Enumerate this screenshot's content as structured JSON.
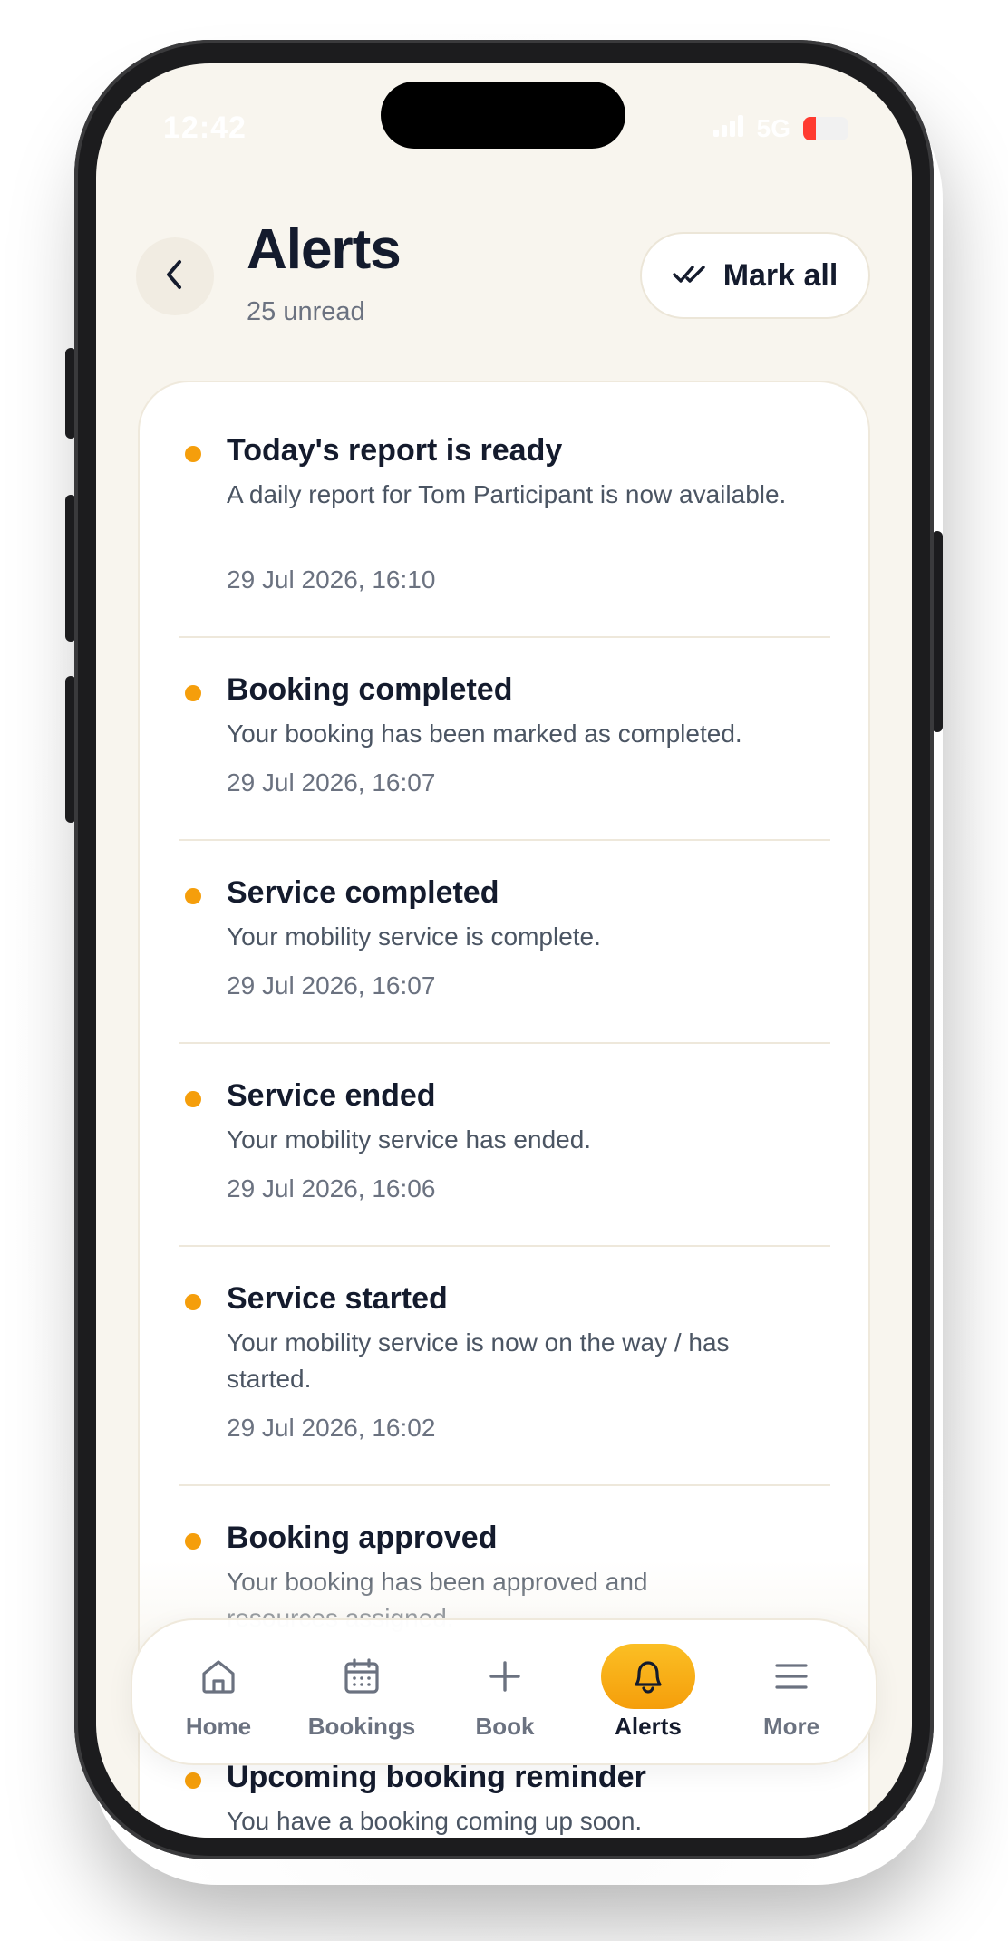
{
  "status_bar": {
    "time": "12:42",
    "network": "5G",
    "battery": "19"
  },
  "header": {
    "title": "Alerts",
    "unread": "25 unread",
    "mark_all_label": "Mark all"
  },
  "alerts": [
    {
      "title": "Today's report is ready",
      "body": "A daily report for Tom Participant is now available.",
      "time": "29 Jul 2026, 16:10"
    },
    {
      "title": "Booking completed",
      "body": "Your booking has been marked as completed.",
      "time": "29 Jul 2026, 16:07"
    },
    {
      "title": "Service completed",
      "body": "Your mobility service is complete.",
      "time": "29 Jul 2026, 16:07"
    },
    {
      "title": "Service ended",
      "body": "Your mobility service has ended.",
      "time": "29 Jul 2026, 16:06"
    },
    {
      "title": "Service started",
      "body": "Your mobility service is now on the way / has started.",
      "time": "29 Jul 2026, 16:02"
    },
    {
      "title": "Booking approved",
      "body": "Your booking has been approved and resources assigned.",
      "time": ""
    },
    {
      "title": "Upcoming booking reminder",
      "body": "You have a booking coming up soon.",
      "time": ""
    }
  ],
  "tabbar": {
    "items": [
      {
        "label": "Home",
        "icon": "home-icon",
        "active": false
      },
      {
        "label": "Bookings",
        "icon": "calendar-icon",
        "active": false
      },
      {
        "label": "Book",
        "icon": "plus-icon",
        "active": false
      },
      {
        "label": "Alerts",
        "icon": "bell-icon",
        "active": true
      },
      {
        "label": "More",
        "icon": "menu-icon",
        "active": false
      }
    ]
  },
  "colors": {
    "accent": "#f59e0b",
    "background": "#f8f5ee",
    "text_primary": "#141b2d",
    "text_secondary": "#6b7280"
  }
}
